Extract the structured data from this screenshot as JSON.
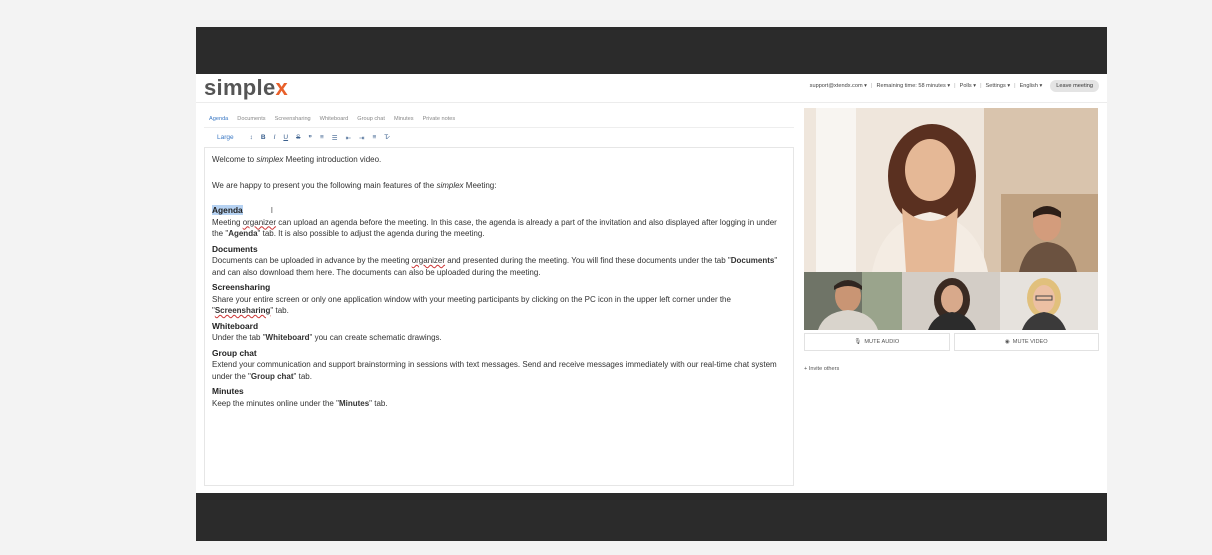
{
  "header": {
    "logo_text": "simple",
    "logo_accent": "x",
    "menu": {
      "user": "support@xtendx.com ▾",
      "remaining": "Remaining time: 58 minutes ▾",
      "polls": "Polls ▾",
      "settings": "Settings ▾",
      "language": "English ▾",
      "leave": "Leave meeting"
    }
  },
  "tabs": [
    "Agenda",
    "Documents",
    "Screensharing",
    "Whiteboard",
    "Group chat",
    "Minutes",
    "Private notes"
  ],
  "toolbar": {
    "size": "Large",
    "buttons": [
      "↕",
      "B",
      "I",
      "U",
      "S",
      "❞",
      "≡",
      "☰",
      "⇤",
      "⇥",
      "≡",
      "T̷"
    ]
  },
  "editor": {
    "intro_prefix": "Welcome to ",
    "intro_brand": "simplex",
    "intro_suffix": " Meeting introduction video.",
    "happy_prefix": "We are happy to present you the following main features of the ",
    "happy_brand": "simplex",
    "happy_suffix": " Meeting:",
    "sections": {
      "agenda": {
        "title": "Agenda",
        "t1": "Meeting ",
        "u1": "organizer",
        "t2": " can upload an agenda before the meeting. In this case, the agenda is already a part of the invitation and also displayed after logging in under the \"",
        "b1": "Agenda",
        "t3": "\" tab. It is also possible to adjust the agenda during the meeting."
      },
      "documents": {
        "title": "Documents",
        "t1": "Documents can be uploaded in advance by the meeting ",
        "u1": "organizer",
        "t2": " and presented during the meeting. You will find these documents under the tab \"",
        "b1": "Documents",
        "t3": "\" and can also download them here. The documents can also be uploaded during the meeting."
      },
      "screensharing": {
        "title": "Screensharing",
        "t1": "Share your entire screen or only one application window with your meeting participants by clicking on the PC icon in the upper left corner under the \"",
        "b1": "Screensharing",
        "t2": "\" tab."
      },
      "whiteboard": {
        "title": "Whiteboard",
        "t1": "Under the tab \"",
        "b1": "Whiteboard",
        "t2": "\" you can create schematic drawings."
      },
      "groupchat": {
        "title": "Group chat",
        "t1": "Extend your communication and support brainstorming in sessions with text messages. Send and receive messages immediately with our real-time chat system under the \"",
        "b1": "Group chat",
        "t2": "\" tab."
      },
      "minutes": {
        "title": "Minutes",
        "t1": "Keep the minutes online under the \"",
        "b1": "Minutes",
        "t2": "\" tab."
      }
    }
  },
  "video": {
    "mute_audio": "MUTE AUDIO",
    "mute_video": "MUTE VIDEO",
    "invite": "+ Invite others"
  },
  "colors": {
    "accent": "#e8602a",
    "link": "#3a78c4",
    "dark_bar": "#2b2b2b"
  }
}
